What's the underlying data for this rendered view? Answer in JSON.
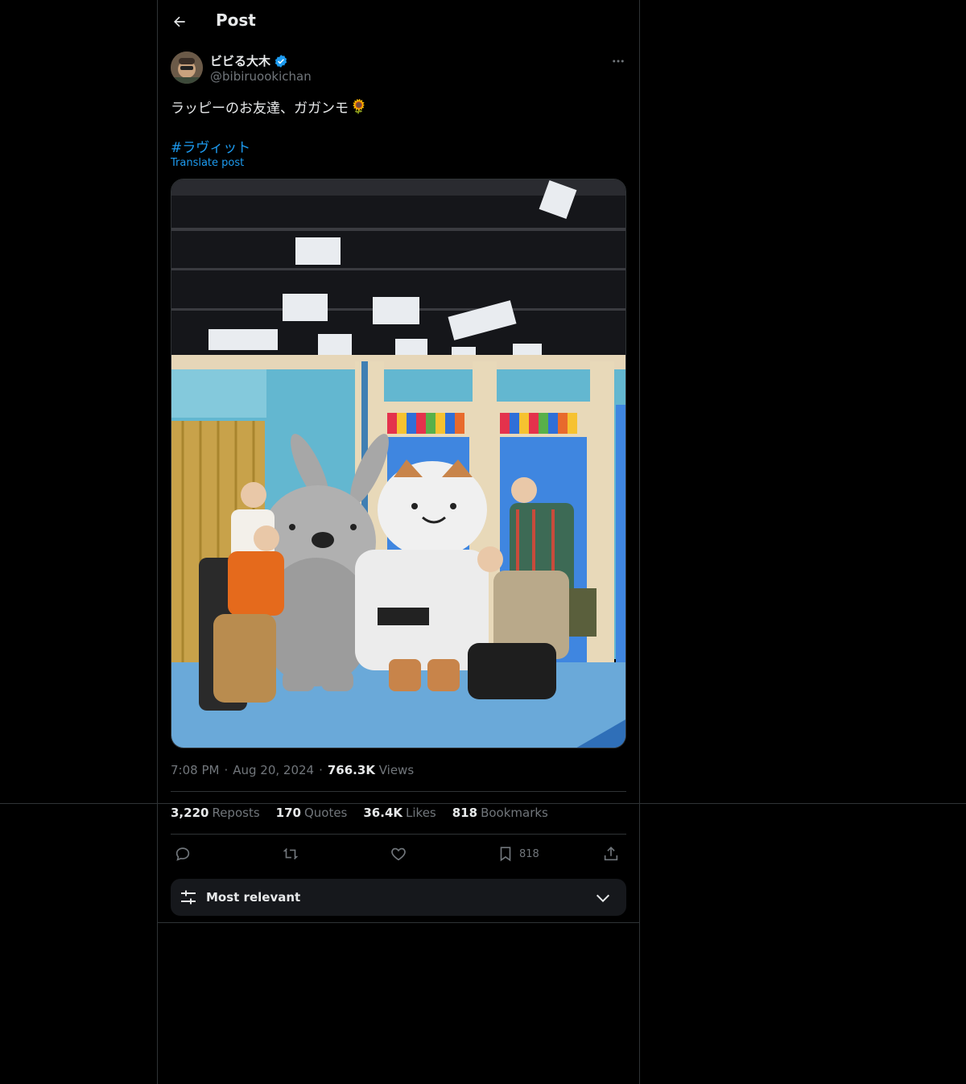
{
  "header": {
    "title": "Post"
  },
  "author": {
    "name": "ビビる大木",
    "handle": "@bibiruookichan"
  },
  "post": {
    "text": "ラッピーのお友達、ガガンモ",
    "emoji": "🌻",
    "hashtag": "#ラヴィット",
    "translate_label": "Translate post"
  },
  "meta": {
    "time": "7:08 PM",
    "dot1": "·",
    "date": "Aug 20, 2024",
    "dot2": "·",
    "views_count": "766.3K",
    "views_label": "Views"
  },
  "stats": {
    "reposts_count": "3,220",
    "reposts_label": "Reposts",
    "quotes_count": "170",
    "quotes_label": "Quotes",
    "likes_count": "36.4K",
    "likes_label": "Likes",
    "bookmarks_count": "818",
    "bookmarks_label": "Bookmarks"
  },
  "actions": {
    "bookmark_count": "818"
  },
  "sort": {
    "label": "Most relevant"
  },
  "icons": {
    "back": "back-arrow-icon",
    "verified": "verified-badge-icon",
    "more": "more-icon",
    "reply": "reply-icon",
    "repost": "repost-icon",
    "like": "heart-icon",
    "bookmark": "bookmark-icon",
    "share": "share-icon",
    "sort": "sliders-icon",
    "chevron": "chevron-down-icon"
  },
  "colors": {
    "accent": "#1d9bf0",
    "text": "#e7e9ea",
    "muted": "#71767b",
    "border": "#2f3336",
    "background": "#000000"
  }
}
